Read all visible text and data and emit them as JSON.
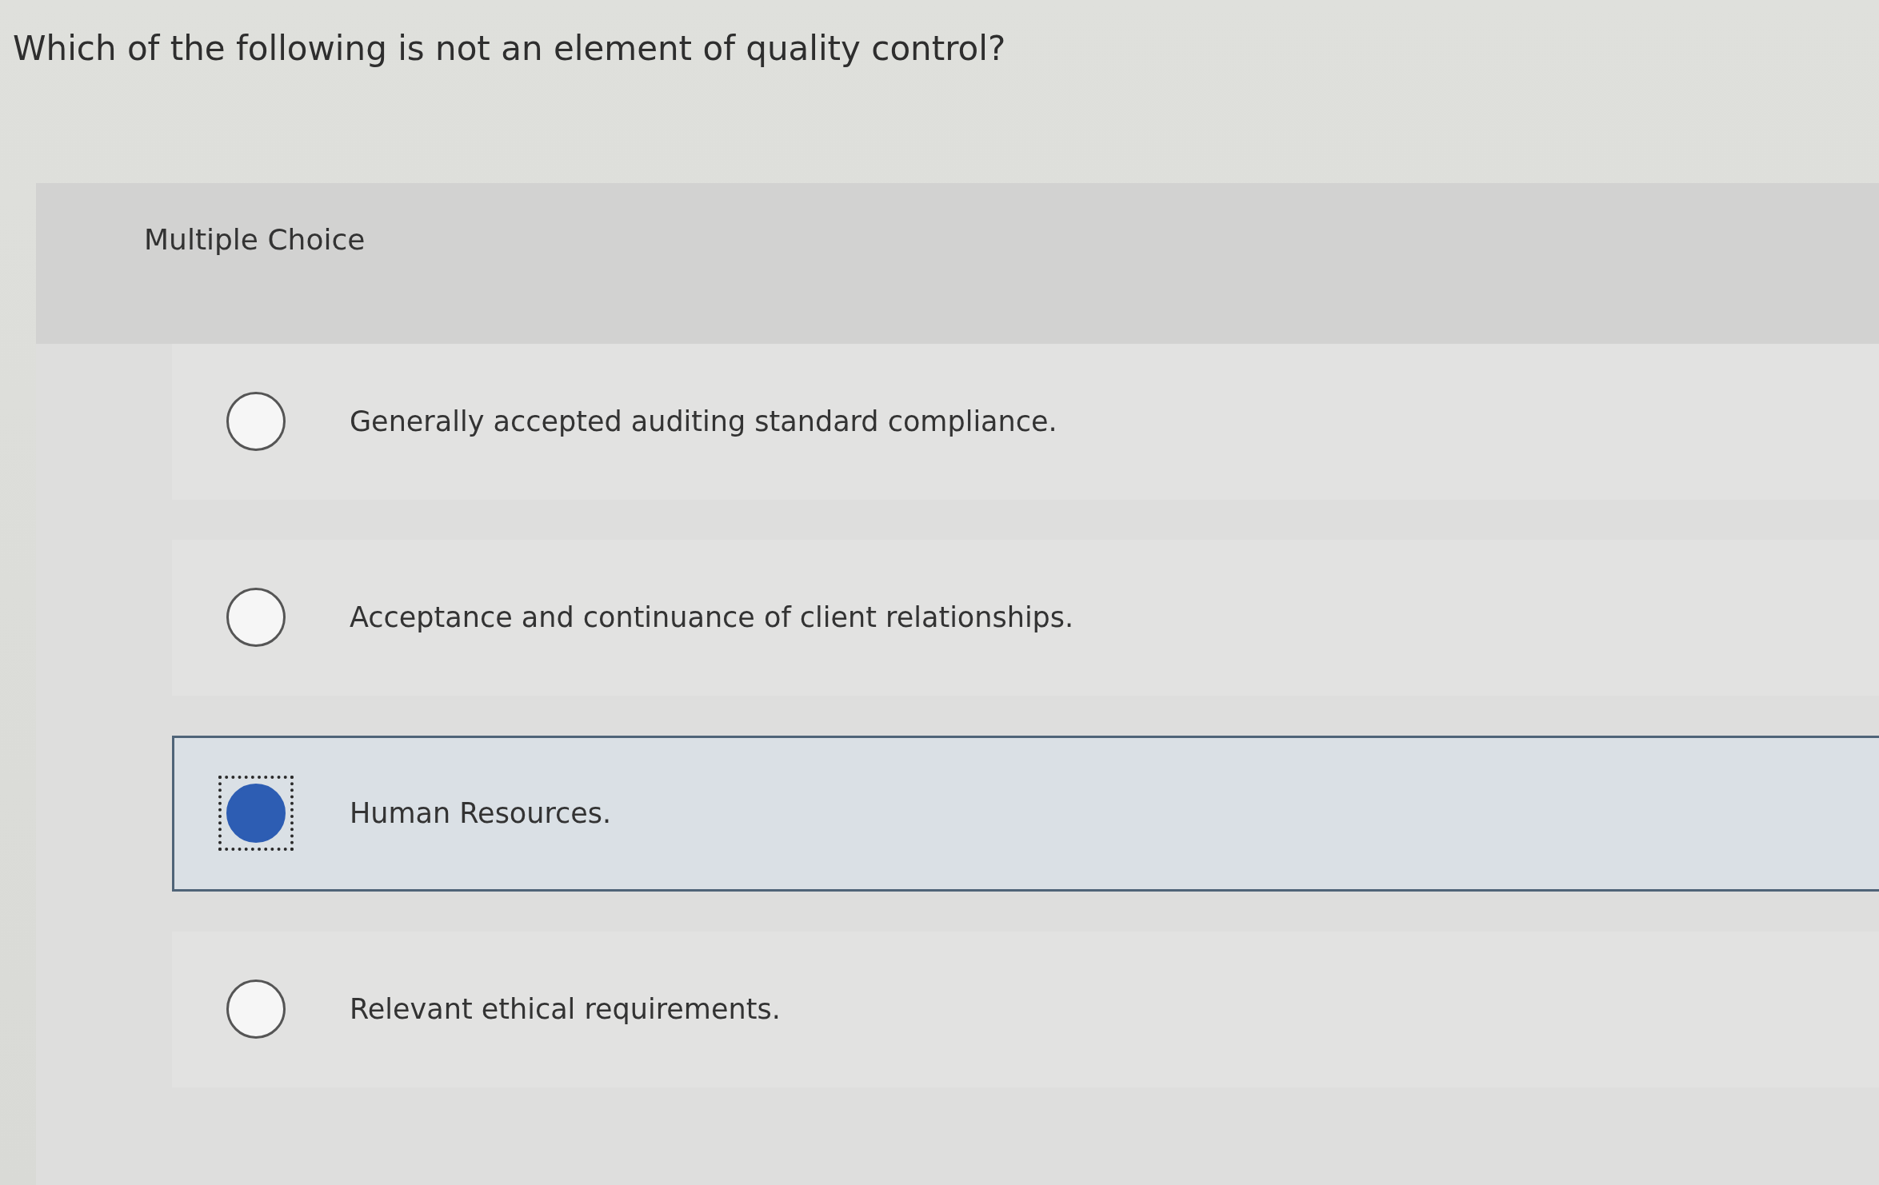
{
  "question": "Which of the following is not an element of quality control?",
  "panel": {
    "label": "Multiple Choice",
    "options": [
      {
        "text": "Generally accepted auditing standard compliance.",
        "selected": false,
        "focused": false
      },
      {
        "text": "Acceptance and continuance of client relationships.",
        "selected": false,
        "focused": false
      },
      {
        "text": "Human Resources.",
        "selected": true,
        "focused": true
      },
      {
        "text": "Relevant ethical requirements.",
        "selected": false,
        "focused": false
      }
    ]
  }
}
